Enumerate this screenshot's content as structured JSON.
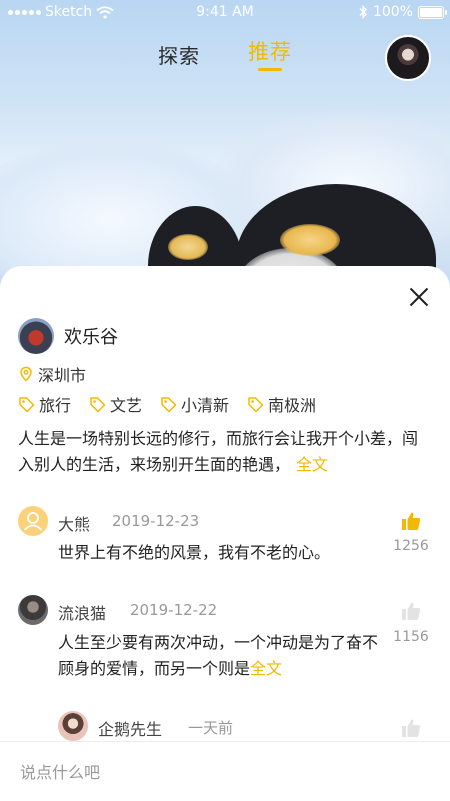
{
  "status_bar": {
    "carrier": "Sketch",
    "time": "9:41 AM",
    "battery": "100%"
  },
  "tabs": [
    {
      "label": "探索"
    },
    {
      "label": "推荐",
      "active": true
    }
  ],
  "colors": {
    "accent": "#f5b800",
    "text": "#222222",
    "muted": "#999999"
  },
  "post": {
    "author": "欢乐谷",
    "location": "深圳市",
    "tags": [
      "旅行",
      "文艺",
      "小清新",
      "南极洲"
    ],
    "content": "人生是一场特别长远的修行，而旅行会让我开个小差，闯入别人的生活，来场别开生面的艳遇，",
    "more_label": "全文"
  },
  "comments": [
    {
      "name": "大熊",
      "date": "2019-12-23",
      "text": "世界上有不绝的风景，我有不老的心。",
      "likes": "1256",
      "liked": true
    },
    {
      "name": "流浪猫",
      "date": "2019-12-22",
      "text": "人生至少要有两次冲动，一个冲动是为了奋不顾身的爱情，而另一个则是",
      "more_label": "全文",
      "likes": "1156",
      "liked": false
    },
    {
      "name": "企鹅先生",
      "date": "一天前",
      "liked": false
    }
  ],
  "input": {
    "placeholder": "说点什么吧"
  },
  "icons": {
    "close": "close-icon",
    "location": "location-pin-icon",
    "tag": "tag-icon",
    "like": "thumbs-up-icon"
  }
}
